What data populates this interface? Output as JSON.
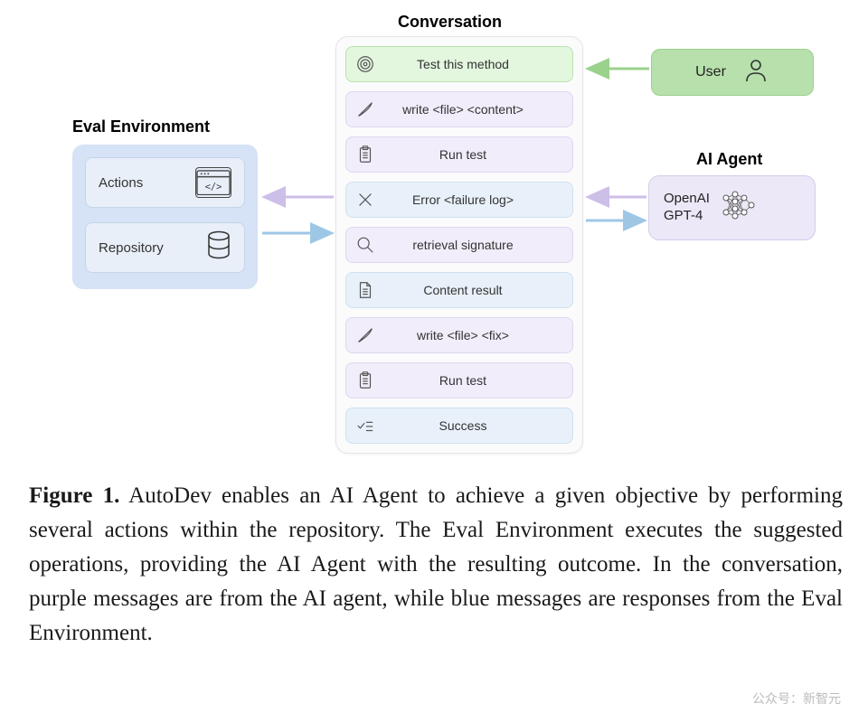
{
  "eval": {
    "title": "Eval Environment",
    "actions": "Actions",
    "repository": "Repository"
  },
  "conversation": {
    "title": "Conversation",
    "items": [
      {
        "label": "Test this method",
        "style": "green",
        "icon": "target"
      },
      {
        "label": "write <file> <content>",
        "style": "purple",
        "icon": "quill"
      },
      {
        "label": "Run test",
        "style": "purple",
        "icon": "clipboard"
      },
      {
        "label": "Error <failure log>",
        "style": "blue",
        "icon": "x"
      },
      {
        "label": "retrieval signature",
        "style": "purple",
        "icon": "search"
      },
      {
        "label": "Content result",
        "style": "blue",
        "icon": "doc"
      },
      {
        "label": "write <file> <fix>",
        "style": "purple",
        "icon": "quill"
      },
      {
        "label": "Run test",
        "style": "purple",
        "icon": "clipboard"
      },
      {
        "label": "Success",
        "style": "blue",
        "icon": "checklist"
      }
    ]
  },
  "user": {
    "label": "User"
  },
  "agent": {
    "title": "AI Agent",
    "model": "OpenAI\nGPT-4"
  },
  "caption": {
    "figlabel": "Figure 1.",
    "text": " AutoDev enables an AI Agent to achieve a given objective by performing several actions within the repository. The Eval Environment executes the suggested operations, providing the AI Agent with the resulting outcome. In the conversation, purple messages are from the AI agent, while blue messages are responses from the Eval Environment."
  },
  "watermark": "公众号：新智元",
  "colors": {
    "user_green": "#b7e0ac",
    "agent_purple": "#ece8f7",
    "eval_blue": "#d6e2f5",
    "msg_green": "#e3f6de",
    "msg_purple": "#f1edfa",
    "msg_blue": "#e8f1fa"
  }
}
